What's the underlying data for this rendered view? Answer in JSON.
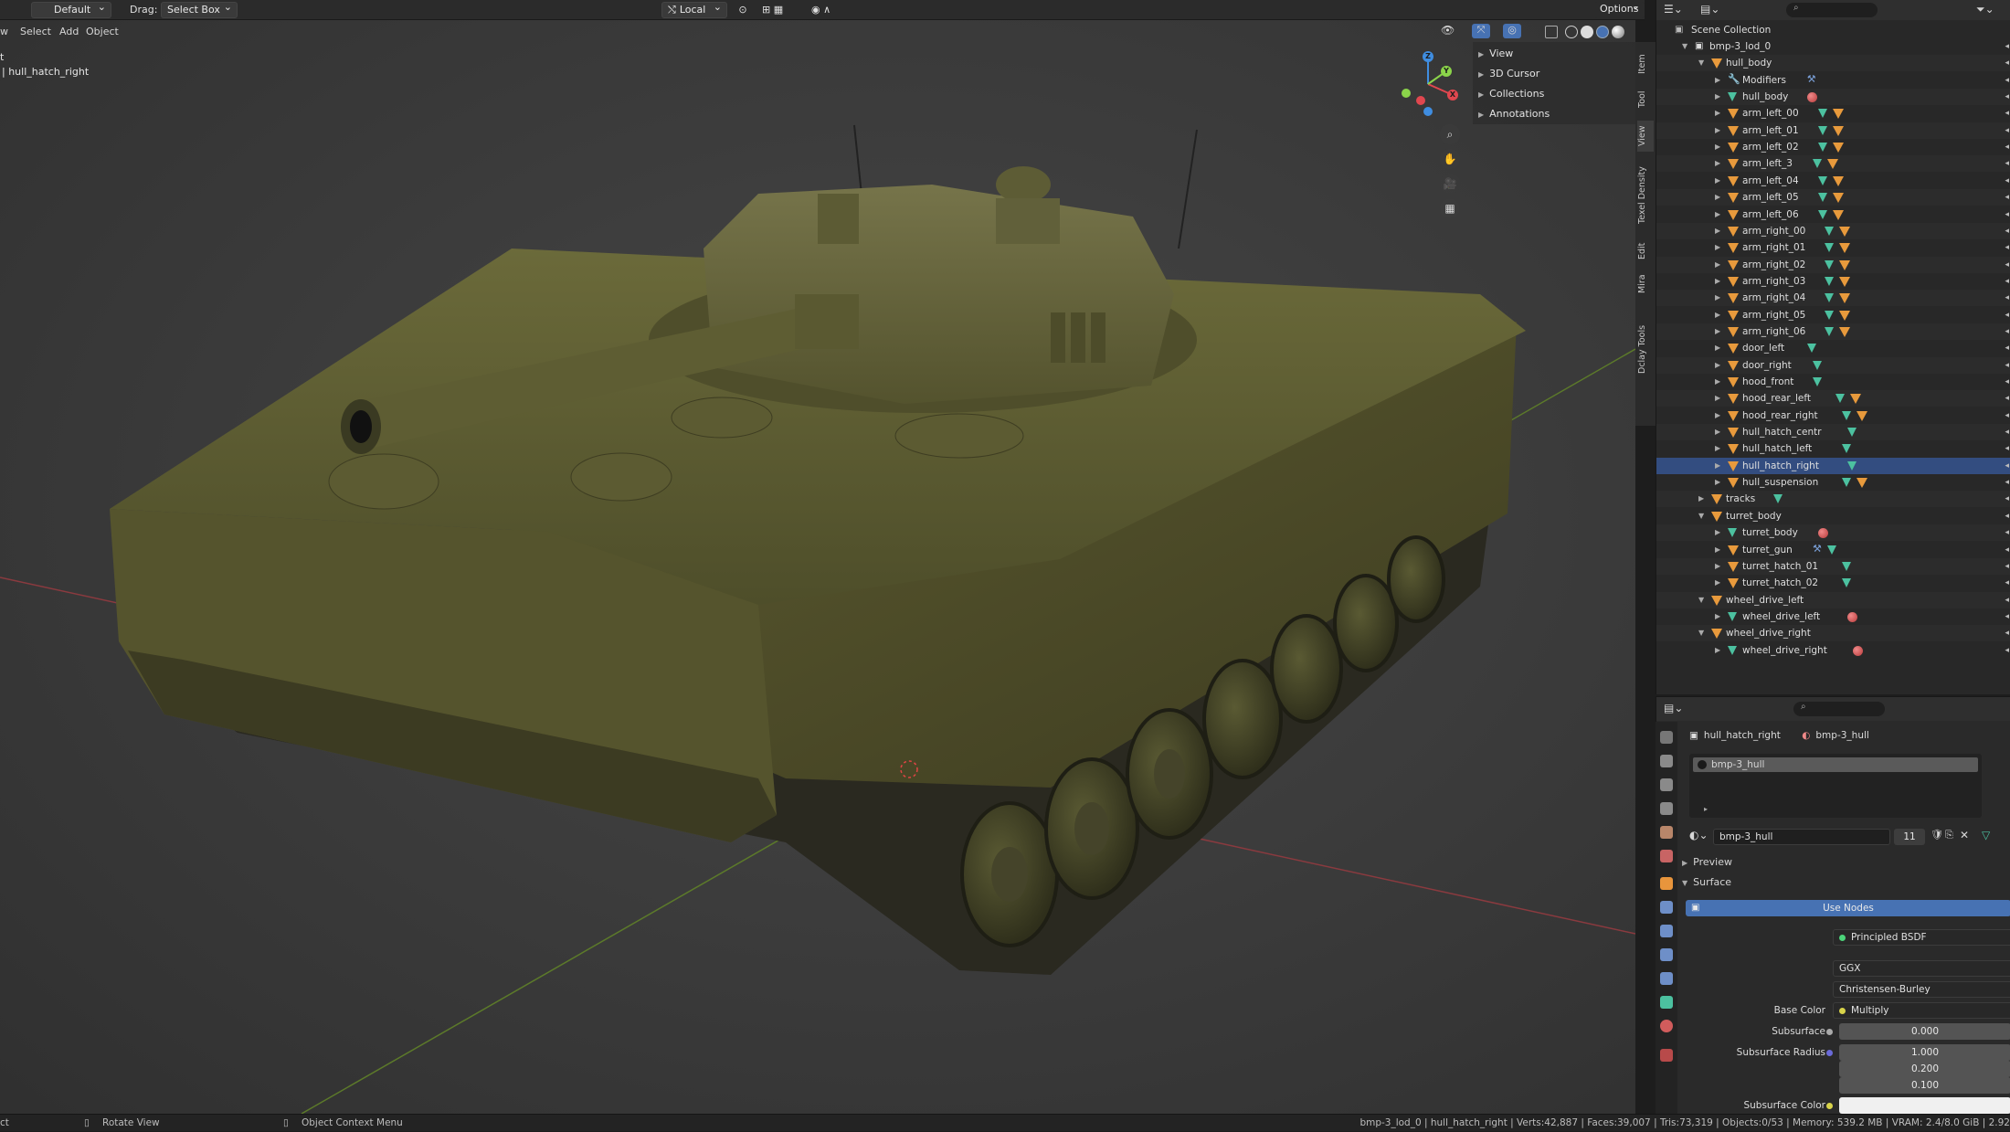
{
  "topbar": {
    "workspace": "Default",
    "drag_label": "Drag:",
    "drag_mode": "Select Box",
    "transform_orientation": "Local",
    "options": "Options"
  },
  "header2": {
    "menu": [
      "w",
      "Select",
      "Add",
      "Object"
    ]
  },
  "viewport": {
    "mode_label": "t",
    "object_label": "| hull_hatch_right"
  },
  "npanel": {
    "items": [
      "View",
      "3D Cursor",
      "Collections",
      "Annotations"
    ]
  },
  "sidebar_tabs": [
    "Item",
    "Tool",
    "View",
    "Texel Density",
    "Edit",
    "Mira",
    "Dclay Tools"
  ],
  "gizmo": {
    "z": "Z",
    "y": "Y",
    "x": "X"
  },
  "outliner": {
    "scene_collection": "Scene Collection",
    "rows": [
      {
        "label": "bmp-3_lod_0",
        "depth": 1,
        "type": "collection",
        "expanded": true
      },
      {
        "label": "hull_body",
        "depth": 2,
        "type": "object",
        "expanded": true
      },
      {
        "label": "Modifiers",
        "depth": 3,
        "type": "modifiers"
      },
      {
        "label": "hull_body",
        "depth": 3,
        "type": "mesh",
        "icons": [
          "mat"
        ]
      },
      {
        "label": "arm_left_00",
        "depth": 3,
        "type": "object",
        "icons": [
          "g",
          "o"
        ]
      },
      {
        "label": "arm_left_01",
        "depth": 3,
        "type": "object",
        "icons": [
          "g",
          "o"
        ]
      },
      {
        "label": "arm_left_02",
        "depth": 3,
        "type": "object",
        "icons": [
          "g",
          "o"
        ]
      },
      {
        "label": "arm_left_3",
        "depth": 3,
        "type": "object",
        "icons": [
          "g",
          "o"
        ]
      },
      {
        "label": "arm_left_04",
        "depth": 3,
        "type": "object",
        "icons": [
          "g",
          "o"
        ]
      },
      {
        "label": "arm_left_05",
        "depth": 3,
        "type": "object",
        "icons": [
          "g",
          "o"
        ]
      },
      {
        "label": "arm_left_06",
        "depth": 3,
        "type": "object",
        "icons": [
          "g",
          "o"
        ]
      },
      {
        "label": "arm_right_00",
        "depth": 3,
        "type": "object",
        "icons": [
          "g",
          "o"
        ]
      },
      {
        "label": "arm_right_01",
        "depth": 3,
        "type": "object",
        "icons": [
          "g",
          "o"
        ]
      },
      {
        "label": "arm_right_02",
        "depth": 3,
        "type": "object",
        "icons": [
          "g",
          "o"
        ]
      },
      {
        "label": "arm_right_03",
        "depth": 3,
        "type": "object",
        "icons": [
          "g",
          "o"
        ]
      },
      {
        "label": "arm_right_04",
        "depth": 3,
        "type": "object",
        "icons": [
          "g",
          "o"
        ]
      },
      {
        "label": "arm_right_05",
        "depth": 3,
        "type": "object",
        "icons": [
          "g",
          "o"
        ]
      },
      {
        "label": "arm_right_06",
        "depth": 3,
        "type": "object",
        "icons": [
          "g",
          "o"
        ]
      },
      {
        "label": "door_left",
        "depth": 3,
        "type": "object",
        "icons": [
          "g"
        ]
      },
      {
        "label": "door_right",
        "depth": 3,
        "type": "object",
        "icons": [
          "g"
        ]
      },
      {
        "label": "hood_front",
        "depth": 3,
        "type": "object",
        "icons": [
          "g"
        ]
      },
      {
        "label": "hood_rear_left",
        "depth": 3,
        "type": "object",
        "icons": [
          "g",
          "o"
        ]
      },
      {
        "label": "hood_rear_right",
        "depth": 3,
        "type": "object",
        "icons": [
          "g",
          "o"
        ]
      },
      {
        "label": "hull_hatch_centr",
        "depth": 3,
        "type": "object",
        "icons": [
          "g"
        ]
      },
      {
        "label": "hull_hatch_left",
        "depth": 3,
        "type": "object",
        "icons": [
          "g"
        ]
      },
      {
        "label": "hull_hatch_right",
        "depth": 3,
        "type": "object",
        "icons": [
          "g"
        ],
        "active": true
      },
      {
        "label": "hull_suspension",
        "depth": 3,
        "type": "object",
        "icons": [
          "g",
          "o"
        ]
      },
      {
        "label": "tracks",
        "depth": 2,
        "type": "object",
        "icons": [
          "g"
        ]
      },
      {
        "label": "turret_body",
        "depth": 2,
        "type": "object",
        "expanded": true
      },
      {
        "label": "turret_body",
        "depth": 3,
        "type": "mesh",
        "icons": [
          "mat"
        ]
      },
      {
        "label": "turret_gun",
        "depth": 3,
        "type": "object",
        "icons": [
          "w",
          "g"
        ]
      },
      {
        "label": "turret_hatch_01",
        "depth": 3,
        "type": "object",
        "icons": [
          "g"
        ]
      },
      {
        "label": "turret_hatch_02",
        "depth": 3,
        "type": "object",
        "icons": [
          "g"
        ]
      },
      {
        "label": "wheel_drive_left",
        "depth": 2,
        "type": "object",
        "expanded": true
      },
      {
        "label": "wheel_drive_left",
        "depth": 3,
        "type": "mesh",
        "icons": [
          "mat"
        ]
      },
      {
        "label": "wheel_drive_right",
        "depth": 2,
        "type": "object",
        "expanded": true
      },
      {
        "label": "wheel_drive_right",
        "depth": 3,
        "type": "mesh",
        "icons": [
          "mat"
        ]
      }
    ]
  },
  "properties": {
    "object_name": "hull_hatch_right",
    "material_name": "bmp-3_hull",
    "slot_name": "bmp-3_hull",
    "material_field": "bmp-3_hull",
    "users": "11",
    "preview_label": "Preview",
    "surface_label": "Surface",
    "use_nodes": "Use Nodes",
    "surface_field_label": "Surface",
    "surface_value": "Principled BSDF",
    "distribution": "GGX",
    "subsurface_method": "Christensen-Burley",
    "base_color_label": "Base Color",
    "base_color_value": "Multiply",
    "subsurface_label": "Subsurface",
    "subsurface_value": "0.000",
    "subsurface_radius_label": "Subsurface Radius",
    "subsurface_radius": [
      "1.000",
      "0.200",
      "0.100"
    ],
    "subsurface_color_label": "Subsurface Color"
  },
  "statusbar": {
    "left_cut": "ct",
    "rotate": "Rotate View",
    "context": "Object Context Menu",
    "stats": "bmp-3_lod_0 | hull_hatch_right | Verts:42,887 | Faces:39,007 | Tris:73,319 | Objects:0/53 | Memory: 539.2 MB | VRAM: 2.4/8.0 GiB | 2.92"
  },
  "colors": {
    "select_blue": "#334d80",
    "use_nodes_blue": "#4772b3",
    "object_orange": "#e89a3c",
    "mesh_green": "#4cc1a0",
    "axis_x": "#e0474f",
    "axis_y": "#8bd44a",
    "axis_z": "#3f8de0"
  }
}
